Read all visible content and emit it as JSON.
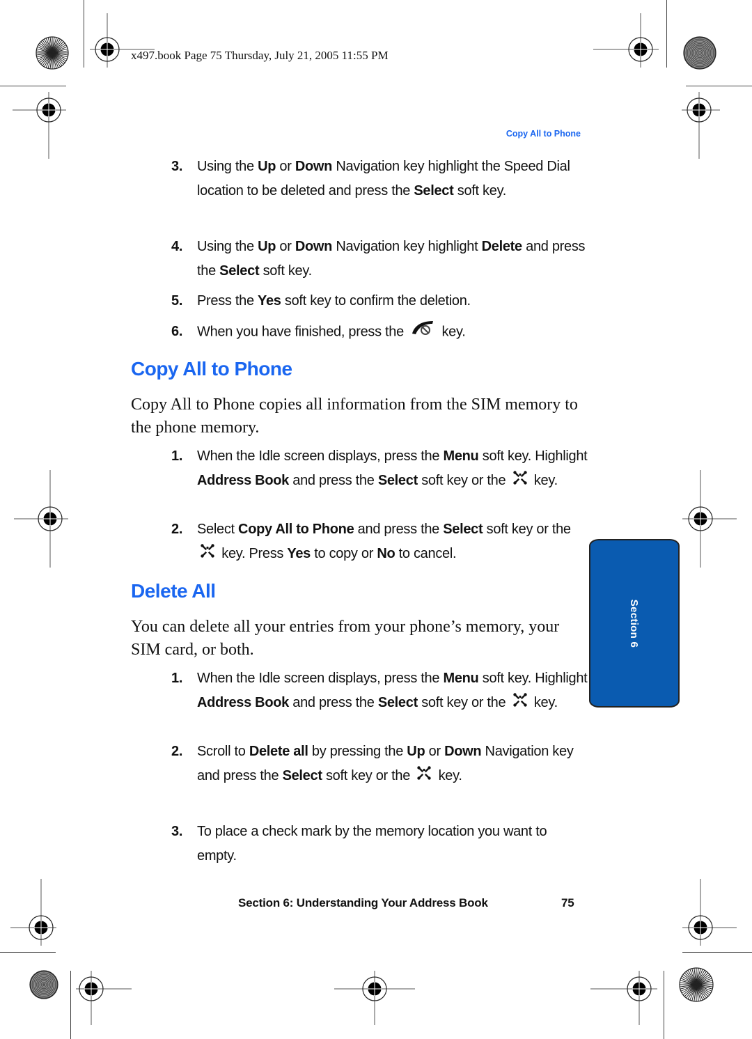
{
  "printer_slug": "x497.book  Page 75  Thursday, July 21, 2005  11:55 PM",
  "running_head": "Copy All to Phone",
  "accent_color": "#1a66f0",
  "tab_color": "#0a5bb0",
  "prev_steps": [
    {
      "num": "3.",
      "parts": [
        {
          "t": "Using the "
        },
        {
          "b": "Up"
        },
        {
          "t": " or "
        },
        {
          "b": "Down"
        },
        {
          "t": " Navigation key highlight the Speed Dial location to be deleted and press the "
        },
        {
          "b": "Select"
        },
        {
          "t": " soft key."
        }
      ]
    },
    {
      "num": "4.",
      "parts": [
        {
          "t": "Using the "
        },
        {
          "b": "Up"
        },
        {
          "t": " or "
        },
        {
          "b": "Down"
        },
        {
          "t": " Navigation key highlight "
        },
        {
          "b": "Delete"
        },
        {
          "t": " and press the "
        },
        {
          "b": "Select"
        },
        {
          "t": " soft key."
        }
      ]
    },
    {
      "num": "5.",
      "parts": [
        {
          "t": "Press the "
        },
        {
          "b": "Yes"
        },
        {
          "t": " soft key to confirm the deletion."
        }
      ]
    },
    {
      "num": "6.",
      "parts": [
        {
          "t": "When you have finished, press the "
        },
        {
          "icon": "end-key-icon"
        },
        {
          "t": " key."
        }
      ]
    }
  ],
  "sections": [
    {
      "heading": "Copy All to Phone",
      "intro": "Copy All to Phone copies all information from the SIM memory to the phone memory.",
      "steps": [
        {
          "num": "1.",
          "parts": [
            {
              "t": "When the Idle screen displays, press the "
            },
            {
              "b": "Menu"
            },
            {
              "t": " soft key. Highlight "
            },
            {
              "b": "Address Book"
            },
            {
              "t": " and press the "
            },
            {
              "b": "Select"
            },
            {
              "t": " soft key or the "
            },
            {
              "icon": "nav-key-icon"
            },
            {
              "t": " key."
            }
          ]
        },
        {
          "num": "2.",
          "parts": [
            {
              "t": "Select "
            },
            {
              "b": "Copy All to Phone"
            },
            {
              "t": " and press the "
            },
            {
              "b": "Select"
            },
            {
              "t": " soft key or the "
            },
            {
              "icon": "nav-key-icon"
            },
            {
              "t": " key. Press "
            },
            {
              "b": "Yes"
            },
            {
              "t": " to copy or "
            },
            {
              "b": "No"
            },
            {
              "t": " to cancel."
            }
          ]
        }
      ]
    },
    {
      "heading": "Delete All",
      "intro": "You can delete all your entries from your phone’s memory, your SIM card, or both.",
      "steps": [
        {
          "num": "1.",
          "parts": [
            {
              "t": "When the Idle screen displays, press the "
            },
            {
              "b": "Menu"
            },
            {
              "t": " soft key. Highlight "
            },
            {
              "b": "Address Book"
            },
            {
              "t": " and press the "
            },
            {
              "b": "Select"
            },
            {
              "t": " soft key or the "
            },
            {
              "icon": "nav-key-icon"
            },
            {
              "t": " key."
            }
          ]
        },
        {
          "num": "2.",
          "parts": [
            {
              "t": "Scroll to "
            },
            {
              "b": "Delete all"
            },
            {
              "t": " by pressing the "
            },
            {
              "b": "Up"
            },
            {
              "t": " or "
            },
            {
              "b": "Down"
            },
            {
              "t": " Navigation key and press the "
            },
            {
              "b": "Select"
            },
            {
              "t": " soft key or the "
            },
            {
              "icon": "nav-key-icon"
            },
            {
              "t": " key."
            }
          ]
        },
        {
          "num": "3.",
          "parts": [
            {
              "t": "To place a check mark by the memory location you want to empty."
            }
          ]
        }
      ]
    }
  ],
  "side_tab": "Section 6",
  "footer": {
    "section_title": "Section 6: Understanding Your Address Book",
    "page_number": "75"
  }
}
